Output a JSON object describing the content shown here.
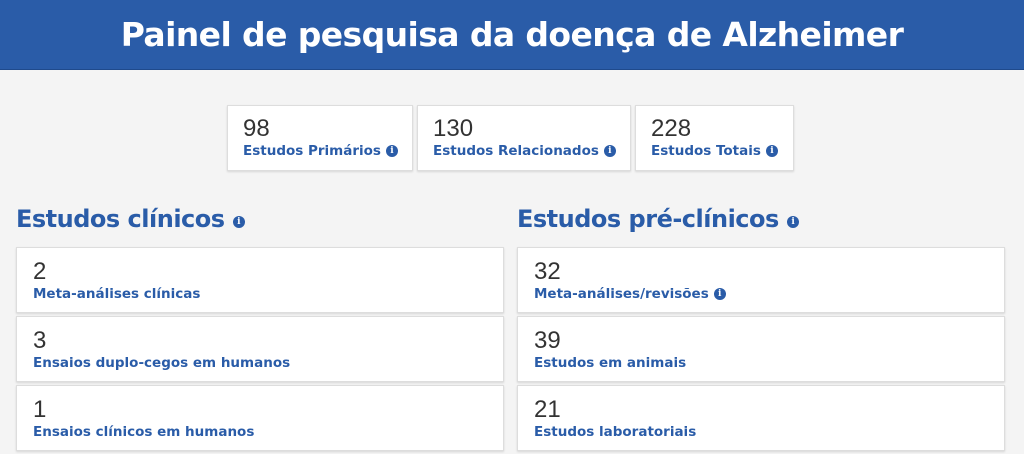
{
  "header": {
    "title": "Painel de pesquisa da doença de Alzheimer"
  },
  "summary": [
    {
      "value": "98",
      "label": "Estudos Primários"
    },
    {
      "value": "130",
      "label": "Estudos Relacionados"
    },
    {
      "value": "228",
      "label": "Estudos Totais"
    }
  ],
  "clinical": {
    "title": "Estudos clínicos",
    "items": [
      {
        "value": "2",
        "label": "Meta-análises clínicas"
      },
      {
        "value": "3",
        "label": "Ensaios duplo-cegos em humanos"
      },
      {
        "value": "1",
        "label": "Ensaios clínicos em humanos"
      }
    ]
  },
  "preclinical": {
    "title": "Estudos pré-clínicos",
    "items": [
      {
        "value": "32",
        "label": "Meta-análises/revisões"
      },
      {
        "value": "39",
        "label": "Estudos em animais"
      },
      {
        "value": "21",
        "label": "Estudos laboratoriais"
      }
    ]
  },
  "icons": {
    "info": "info-icon"
  },
  "colors": {
    "header_bg": "#2a5ca8",
    "accent": "#2a5ca8",
    "page_bg": "#f4f4f4"
  }
}
